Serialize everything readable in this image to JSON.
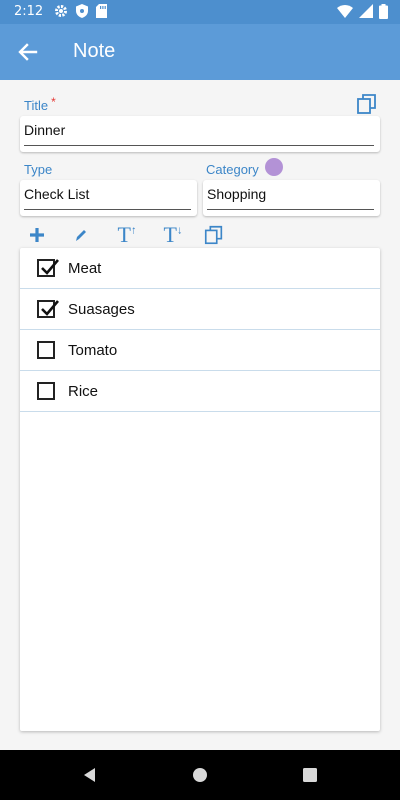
{
  "status_bar": {
    "time": "2:12",
    "icons_left": [
      "gear-icon",
      "shield-icon",
      "sd-card-icon"
    ],
    "icons_right": [
      "wifi-icon",
      "signal-icon",
      "battery-icon"
    ]
  },
  "app_bar": {
    "title": "Note",
    "back_icon": "arrow-left-icon",
    "color": "#5c9bd8"
  },
  "form": {
    "title_label": "Title",
    "title_required_mark": "*",
    "title_value": "Dinner",
    "type_label": "Type",
    "type_value": "Check List",
    "category_label": "Category",
    "category_value": "Shopping",
    "category_color": "#b392d6"
  },
  "toolbar": {
    "tools": [
      "add-icon",
      "edit-pencil-icon",
      "text-size-increase-icon",
      "text-size-decrease-icon",
      "copy-icon"
    ],
    "increase_glyph": "T",
    "decrease_glyph": "T"
  },
  "checklist": [
    {
      "label": "Meat",
      "checked": true
    },
    {
      "label": "Suasages",
      "checked": true
    },
    {
      "label": "Tomato",
      "checked": false
    },
    {
      "label": "Rice",
      "checked": false
    }
  ],
  "nav_bar": {
    "buttons": [
      "back-triangle-icon",
      "home-circle-icon",
      "recents-square-icon"
    ]
  },
  "colors": {
    "accent": "#3c86c8",
    "status_bar": "#4d8fce",
    "required": "#e53935"
  }
}
